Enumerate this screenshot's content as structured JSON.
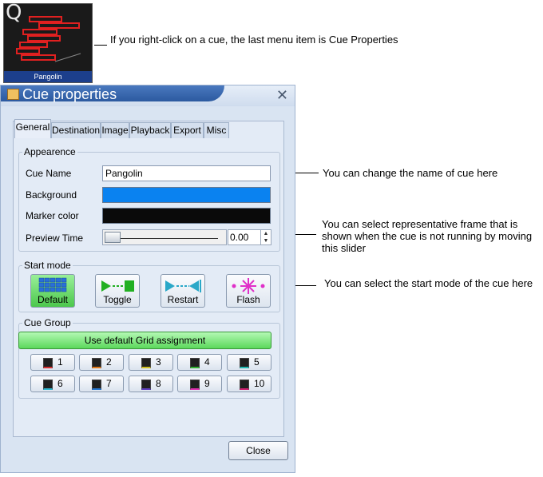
{
  "thumbnail": {
    "letter": "Q",
    "caption": "Pangolin"
  },
  "callouts": {
    "right_click": "If you right-click on a cue, the last menu item is Cue Properties",
    "change_name": "You can change the name of cue here",
    "preview_frame": "You can select representative frame that is shown when the cue is not running by moving this slider",
    "start_mode": "You can select the start mode of the cue here"
  },
  "dialog": {
    "title": "Cue properties",
    "close_glyph": "✕",
    "tabs": [
      "General",
      "Destination",
      "Image",
      "Playback",
      "Export",
      "Misc"
    ],
    "appearance": {
      "legend": "Appearence",
      "cue_name_label": "Cue Name",
      "cue_name_value": "Pangolin",
      "background_label": "Background",
      "background_color": "#0a82f0",
      "marker_label": "Marker color",
      "marker_color": "#0a0a0a",
      "preview_label": "Preview Time",
      "preview_value": "0.00"
    },
    "start_mode": {
      "legend": "Start mode",
      "buttons": [
        "Default",
        "Toggle",
        "Restart",
        "Flash"
      ],
      "selected": "Default"
    },
    "cue_group": {
      "legend": "Cue Group",
      "default_button": "Use default Grid assignment",
      "groups": [
        {
          "label": "1",
          "color": "#d83030"
        },
        {
          "label": "2",
          "color": "#e07818"
        },
        {
          "label": "3",
          "color": "#d0c020"
        },
        {
          "label": "4",
          "color": "#30b030"
        },
        {
          "label": "5",
          "color": "#20b8b0"
        },
        {
          "label": "6",
          "color": "#30b8d0"
        },
        {
          "label": "7",
          "color": "#2878d0"
        },
        {
          "label": "8",
          "color": "#6040c0"
        },
        {
          "label": "9",
          "color": "#e030b0"
        },
        {
          "label": "10",
          "color": "#d02070"
        }
      ]
    },
    "close_label": "Close"
  }
}
